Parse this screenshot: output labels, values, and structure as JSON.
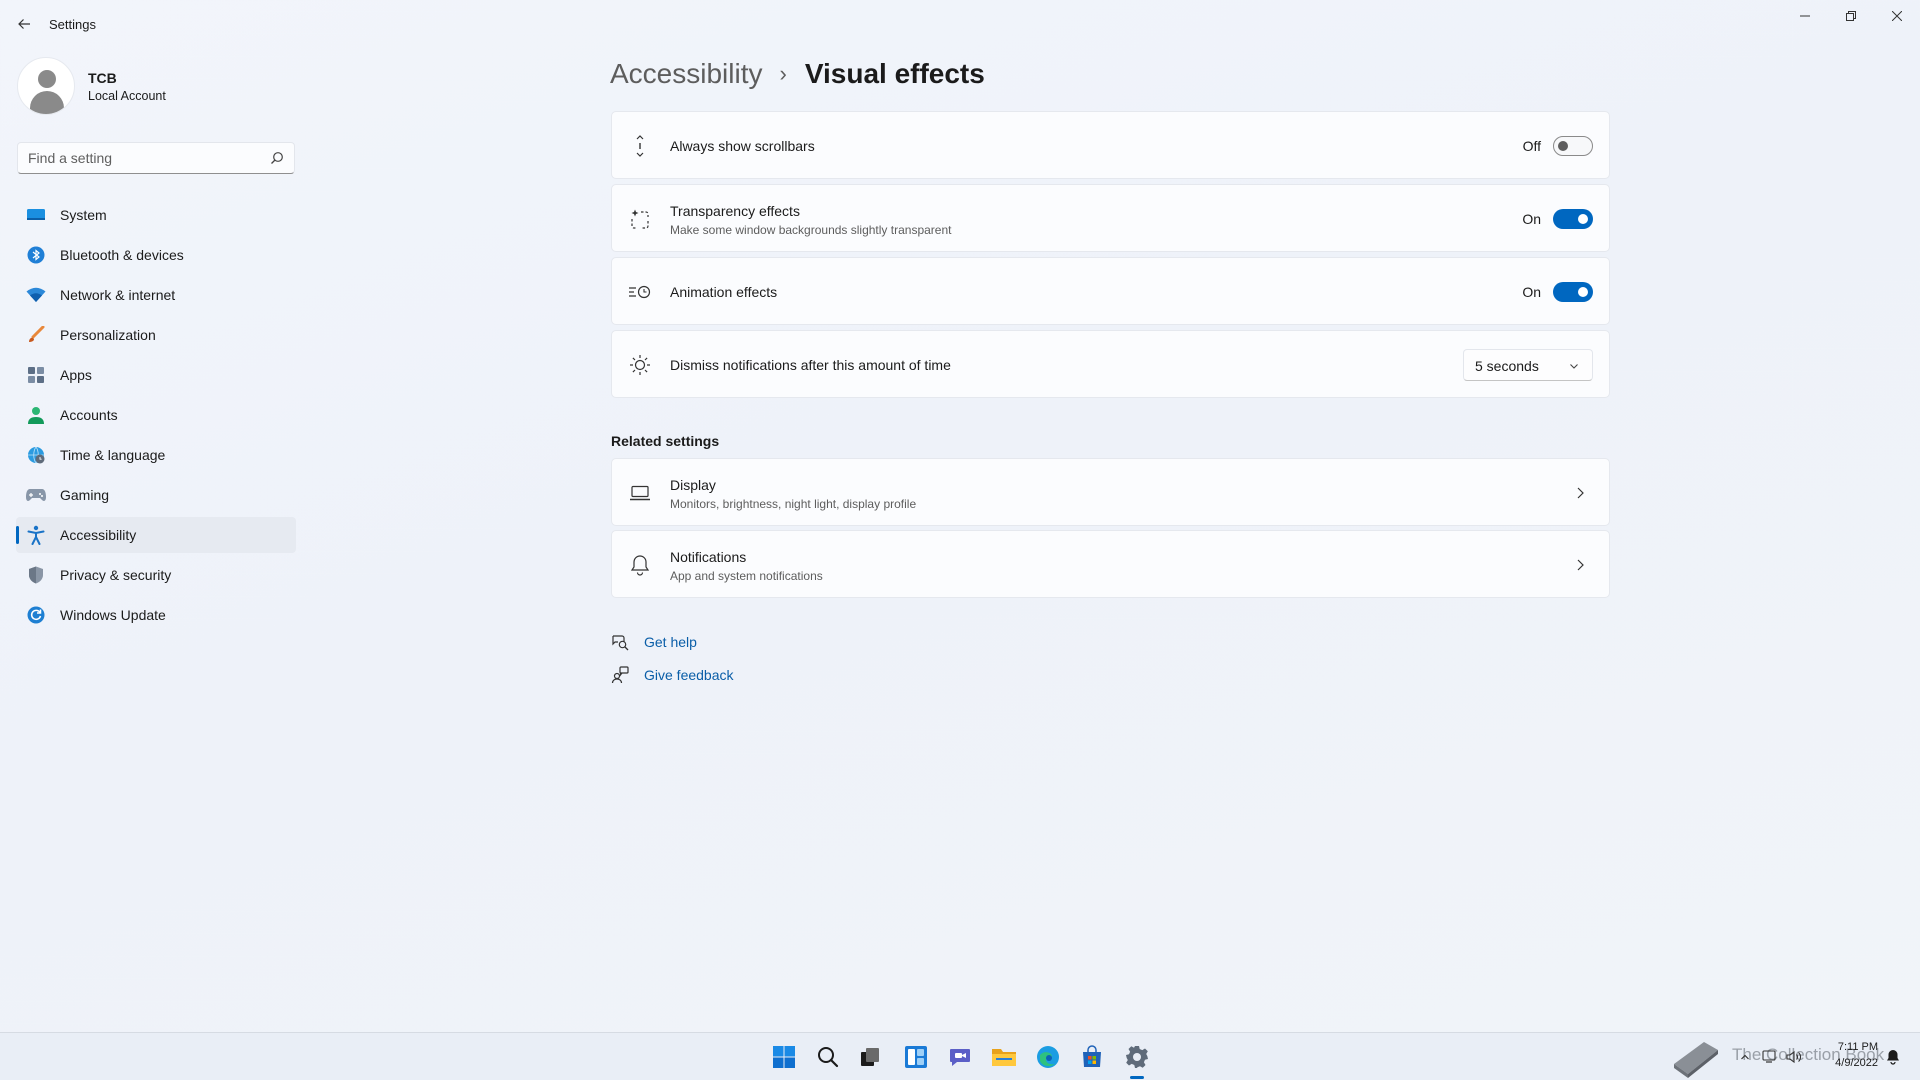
{
  "window": {
    "title": "Settings",
    "controls": [
      "minimize",
      "restore",
      "close"
    ]
  },
  "profile": {
    "name": "TCB",
    "account_type": "Local Account"
  },
  "search": {
    "placeholder": "Find a setting"
  },
  "sidebar": {
    "items": [
      {
        "label": "System",
        "icon": "system-icon",
        "active": false
      },
      {
        "label": "Bluetooth & devices",
        "icon": "bluetooth-icon",
        "active": false
      },
      {
        "label": "Network & internet",
        "icon": "wifi-icon",
        "active": false
      },
      {
        "label": "Personalization",
        "icon": "brush-icon",
        "active": false
      },
      {
        "label": "Apps",
        "icon": "apps-icon",
        "active": false
      },
      {
        "label": "Accounts",
        "icon": "accounts-icon",
        "active": false
      },
      {
        "label": "Time & language",
        "icon": "globe-clock-icon",
        "active": false
      },
      {
        "label": "Gaming",
        "icon": "gamepad-icon",
        "active": false
      },
      {
        "label": "Accessibility",
        "icon": "accessibility-icon",
        "active": true
      },
      {
        "label": "Privacy & security",
        "icon": "shield-icon",
        "active": false
      },
      {
        "label": "Windows Update",
        "icon": "update-icon",
        "active": false
      }
    ]
  },
  "breadcrumb": {
    "parent": "Accessibility",
    "separator": "›",
    "current": "Visual effects"
  },
  "settings": {
    "scrollbars": {
      "title": "Always show scrollbars",
      "state": "Off",
      "enabled": false
    },
    "transparency": {
      "title": "Transparency effects",
      "description": "Make some window backgrounds slightly transparent",
      "state": "On",
      "enabled": true
    },
    "animation": {
      "title": "Animation effects",
      "state": "On",
      "enabled": true
    },
    "notifications_timeout": {
      "title": "Dismiss notifications after this amount of time",
      "value": "5 seconds"
    }
  },
  "related": {
    "title": "Related settings",
    "display": {
      "title": "Display",
      "description": "Monitors, brightness, night light, display profile"
    },
    "notifications": {
      "title": "Notifications",
      "description": "App and system notifications"
    }
  },
  "help": {
    "get_help": "Get help",
    "give_feedback": "Give feedback"
  },
  "taskbar": {
    "apps": [
      "start-icon",
      "search-icon",
      "task-view-icon",
      "widgets-icon",
      "chat-icon",
      "file-explorer-icon",
      "edge-icon",
      "store-icon",
      "settings-icon"
    ],
    "watermark": "The Collection Book",
    "time": "7:11 PM",
    "date": "4/9/2022"
  },
  "colors": {
    "accent": "#0067c0",
    "link": "#0a5ea8",
    "card": "#fbfcfe"
  }
}
